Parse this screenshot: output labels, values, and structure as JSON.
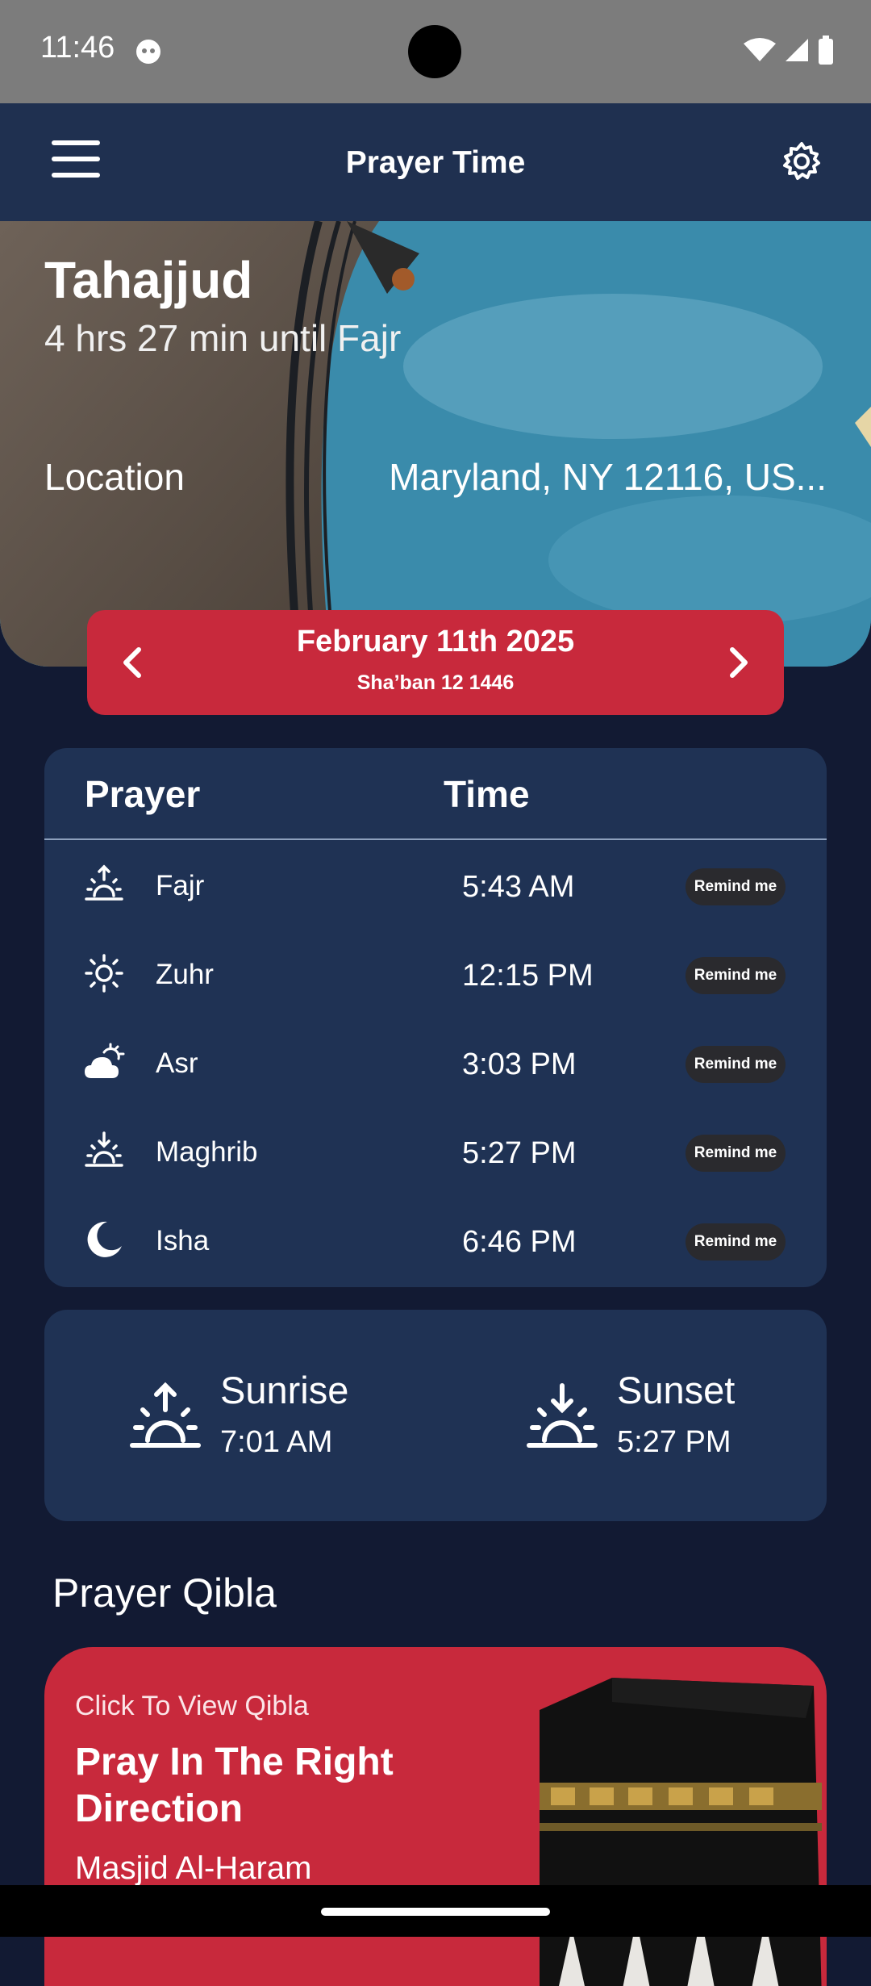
{
  "status_bar": {
    "time": "11:46"
  },
  "app_bar": {
    "title": "Prayer Time"
  },
  "hero": {
    "current_prayer": "Tahajjud",
    "countdown": "4 hrs 27 min until Fajr",
    "location_label": "Location",
    "location_value": "Maryland, NY 12116, US..."
  },
  "date_bar": {
    "gregorian": "February 11th 2025",
    "hijri": "Sha’ban 12 1446"
  },
  "prayer_table": {
    "col_prayer": "Prayer",
    "col_time": "Time",
    "rows": [
      {
        "name": "Fajr",
        "time": "5:43 AM",
        "remind": "Remind me",
        "icon": "sunrise-icon"
      },
      {
        "name": "Zuhr",
        "time": "12:15 PM",
        "remind": "Remind me",
        "icon": "sun-icon"
      },
      {
        "name": "Asr",
        "time": "3:03 PM",
        "remind": "Remind me",
        "icon": "cloud-sun-icon"
      },
      {
        "name": "Maghrib",
        "time": "5:27 PM",
        "remind": "Remind me",
        "icon": "sunset-icon"
      },
      {
        "name": "Isha",
        "time": "6:46 PM",
        "remind": "Remind me",
        "icon": "moon-icon"
      }
    ]
  },
  "sun_times": {
    "sunrise_label": "Sunrise",
    "sunrise_time": "7:01 AM",
    "sunset_label": "Sunset",
    "sunset_time": "5:27 PM"
  },
  "qibla": {
    "heading": "Prayer Qibla",
    "small": "Click To View Qibla",
    "title": "Pray In The Right Direction",
    "masjid": "Masjid Al-Haram"
  },
  "colors": {
    "background": "#121a33",
    "card": "#1f3254",
    "accent": "#c8293c",
    "app_bar": "#1f3050"
  }
}
